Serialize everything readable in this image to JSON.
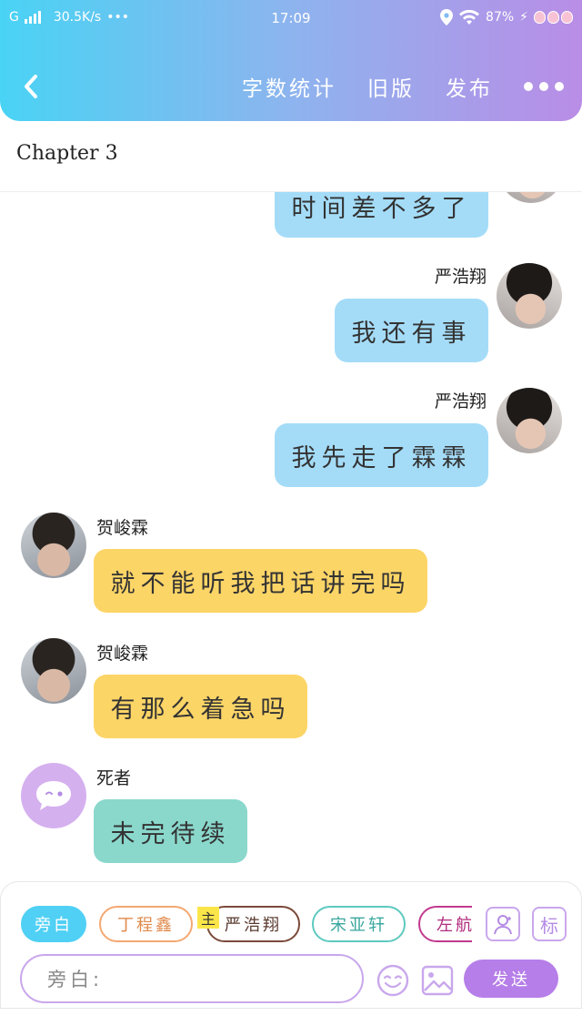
{
  "status_bar": {
    "network": "G",
    "speed": "30.5K/s",
    "more": "•••",
    "time": "17:09",
    "battery": "87%"
  },
  "toolbar": {
    "word_count_label": "字数统计",
    "old_version_label": "旧版",
    "publish_label": "发布"
  },
  "chapter": {
    "title": "Chapter 3"
  },
  "messages": [
    {
      "side": "right",
      "speaker": "",
      "text": "时间差不多了",
      "color": "#a4dcf8"
    },
    {
      "side": "right",
      "speaker": "严浩翔",
      "text": "我还有事",
      "color": "#a4dcf8"
    },
    {
      "side": "right",
      "speaker": "严浩翔",
      "text": "我先走了霖霖",
      "color": "#a4dcf8"
    },
    {
      "side": "left",
      "speaker": "贺峻霖",
      "text": "就不能听我把话讲完吗",
      "color": "#fcd567"
    },
    {
      "side": "left",
      "speaker": "贺峻霖",
      "text": "有那么着急吗",
      "color": "#fcd567"
    },
    {
      "side": "left",
      "speaker": "死者",
      "text": "未完待续",
      "color": "#8ad8cc"
    }
  ],
  "roles": [
    {
      "label": "旁白",
      "color": "#4fd0f4",
      "active": true
    },
    {
      "label": "丁程鑫",
      "color": "#f4a872",
      "active": false
    },
    {
      "label": "严浩翔",
      "color": "#7b4a3a",
      "active": false
    },
    {
      "label": "宋亚轩",
      "color": "#5ec9c0",
      "active": false
    },
    {
      "label": "左航",
      "color": "#c23a8e",
      "active": false
    }
  ],
  "main_badge": "主",
  "tools": {
    "tag_label": "标"
  },
  "composer": {
    "placeholder": "旁白:",
    "send_label": "发送"
  },
  "colors": {
    "header_start": "#49d3f4",
    "header_end": "#b98de6",
    "accent_purple": "#b67ee8"
  }
}
